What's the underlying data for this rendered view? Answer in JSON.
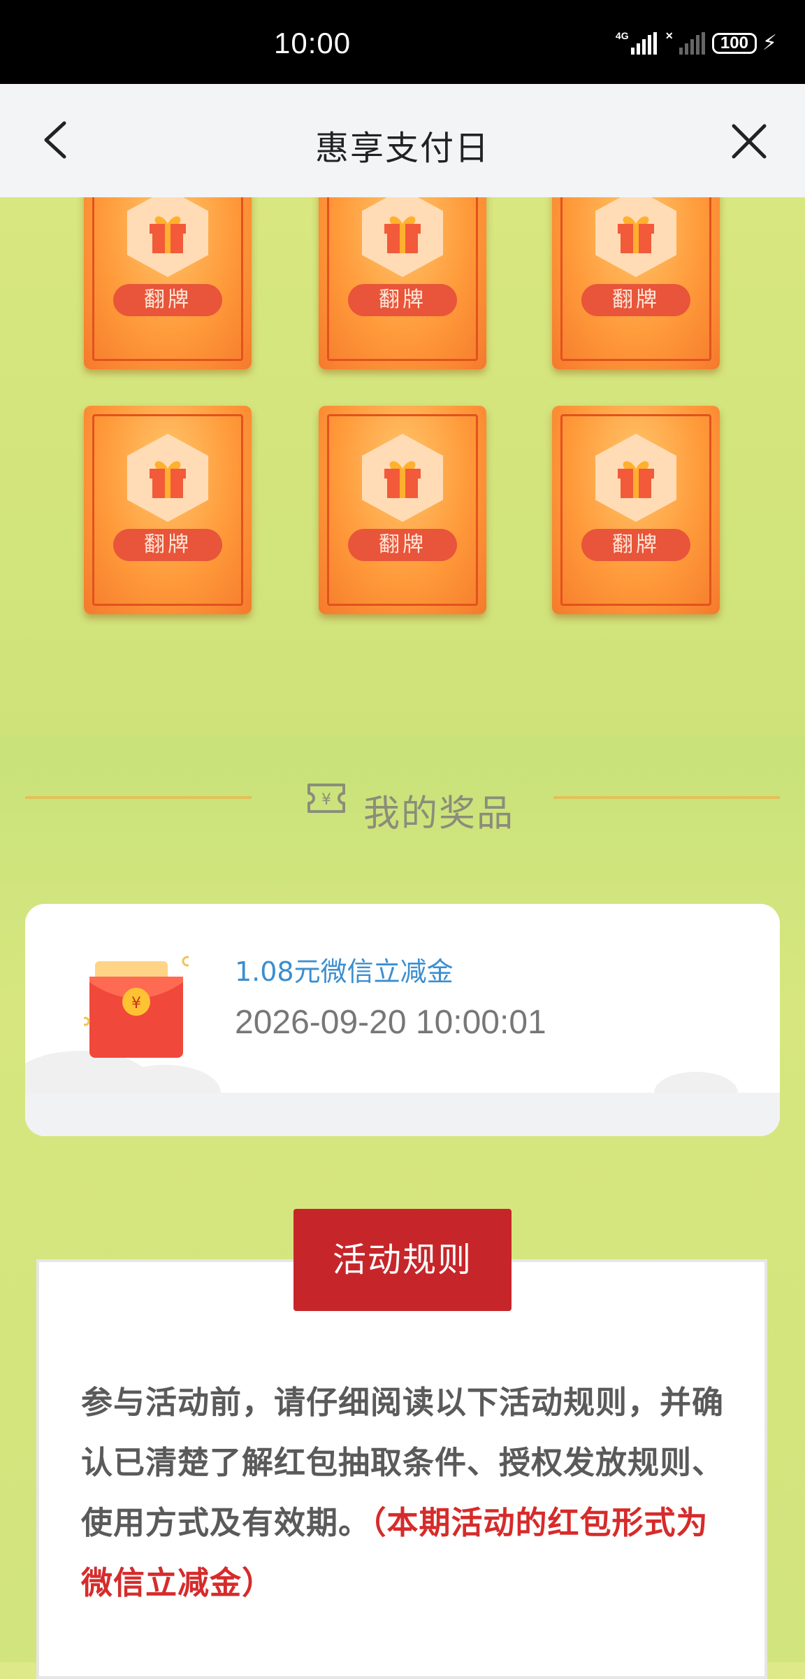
{
  "status_bar": {
    "time": "10:00",
    "signal1_label": "4G",
    "battery": "100"
  },
  "navbar": {
    "title": "惠享支付日"
  },
  "cards": {
    "flip_label": "翻牌",
    "count": 6
  },
  "prizes": {
    "heading": "我的奖品",
    "items": [
      {
        "name": "1.08元微信立减金",
        "time": "2026-09-20 10:00:01"
      }
    ]
  },
  "rules": {
    "button_label": "活动规则",
    "text_main": "参与活动前，请仔细阅读以下活动规则，并确认已清楚了解红包抽取条件、授权发放规则、使用方式及有效期。",
    "text_highlight": "（本期活动的红包形式为微信立减金）"
  },
  "colors": {
    "accent_red": "#c6262a",
    "card_orange": "#ff9a3a",
    "prize_blue": "#3c8ed0"
  }
}
